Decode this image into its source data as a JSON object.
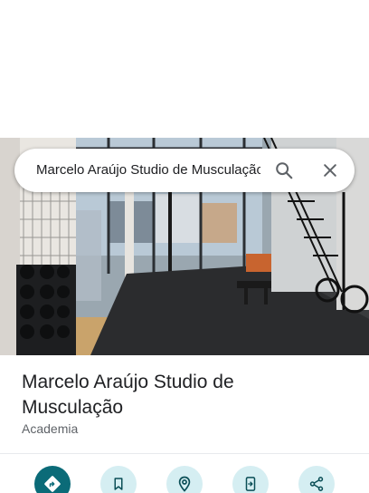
{
  "search": {
    "query": "Marcelo Araújo Studio de Musculação"
  },
  "icons": {
    "search": "search-icon",
    "close": "close-icon",
    "directions": "directions-icon",
    "save": "bookmark-icon",
    "nearby": "nearby-icon",
    "send_to_phone": "send-to-phone-icon",
    "share": "share-icon"
  },
  "place": {
    "name": "Marcelo Araújo Studio de Musculação",
    "category": "Academia"
  },
  "colors": {
    "accent": "#0b6b78",
    "action_bg": "#d5eef2",
    "title_text": "#202124",
    "secondary_text": "#5f6368"
  }
}
